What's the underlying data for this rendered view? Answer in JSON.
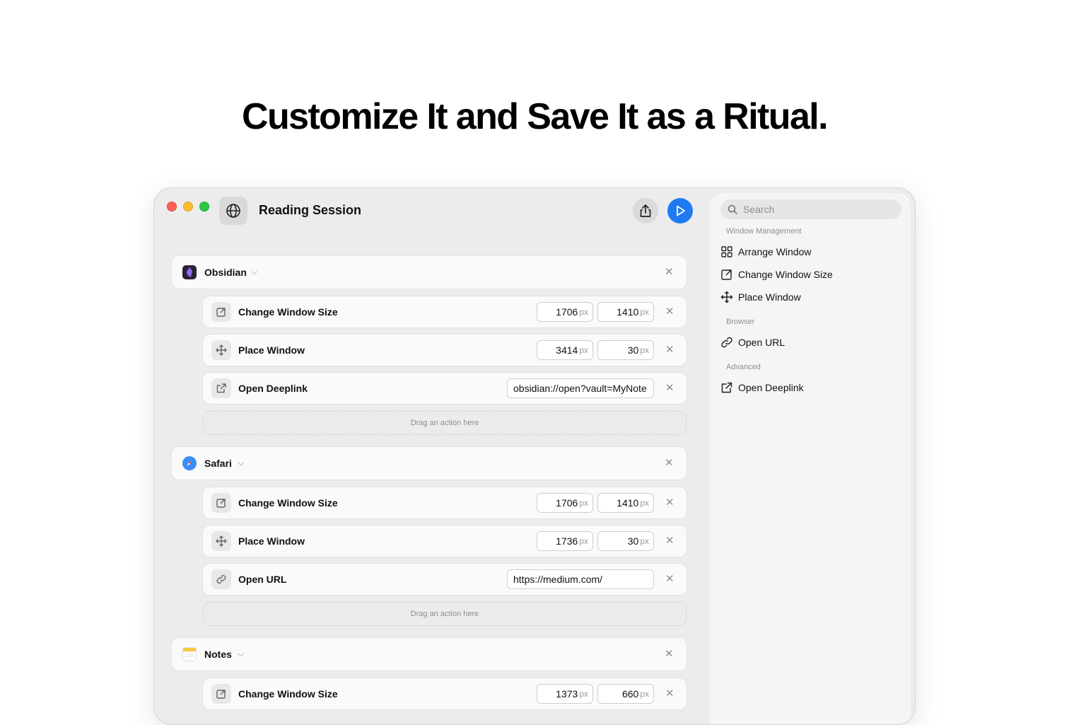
{
  "headline": "Customize It and Save It as a Ritual.",
  "window": {
    "title": "Reading Session",
    "title_icon": "globe-icon",
    "share_icon": "share-icon",
    "run_icon": "play-icon",
    "accent_color": "#1d7af3"
  },
  "groups": [
    {
      "app": "Obsidian",
      "icon": "obsidian-icon",
      "actions": [
        {
          "label": "Change Window Size",
          "icon": "resize-icon",
          "value1": "1706",
          "value2": "1410",
          "unit": "px"
        },
        {
          "label": "Place Window",
          "icon": "move-icon",
          "value1": "3414",
          "value2": "30",
          "unit": "px"
        },
        {
          "label": "Open Deeplink",
          "icon": "external-link-icon",
          "value": "obsidian://open?vault=MyNote"
        }
      ],
      "drop_text": "Drag an action here"
    },
    {
      "app": "Safari",
      "icon": "safari-icon",
      "actions": [
        {
          "label": "Change Window Size",
          "icon": "resize-icon",
          "value1": "1706",
          "value2": "1410",
          "unit": "px"
        },
        {
          "label": "Place Window",
          "icon": "move-icon",
          "value1": "1736",
          "value2": "30",
          "unit": "px"
        },
        {
          "label": "Open URL",
          "icon": "link-icon",
          "value": "https://medium.com/"
        }
      ],
      "drop_text": "Drag an action here"
    },
    {
      "app": "Notes",
      "icon": "notes-icon",
      "actions": [
        {
          "label": "Change Window Size",
          "icon": "resize-icon",
          "value1": "1373",
          "value2": "660",
          "unit": "px"
        }
      ]
    }
  ],
  "sidebar": {
    "search_placeholder": "Search",
    "sections": [
      {
        "title": "Window Management",
        "items": [
          {
            "label": "Arrange Window",
            "icon": "grid-icon"
          },
          {
            "label": "Change Window Size",
            "icon": "resize-icon"
          },
          {
            "label": "Place Window",
            "icon": "move-icon"
          }
        ]
      },
      {
        "title": "Browser",
        "items": [
          {
            "label": "Open URL",
            "icon": "link-icon"
          }
        ]
      },
      {
        "title": "Advanced",
        "items": [
          {
            "label": "Open Deeplink",
            "icon": "external-link-icon"
          }
        ]
      }
    ]
  }
}
